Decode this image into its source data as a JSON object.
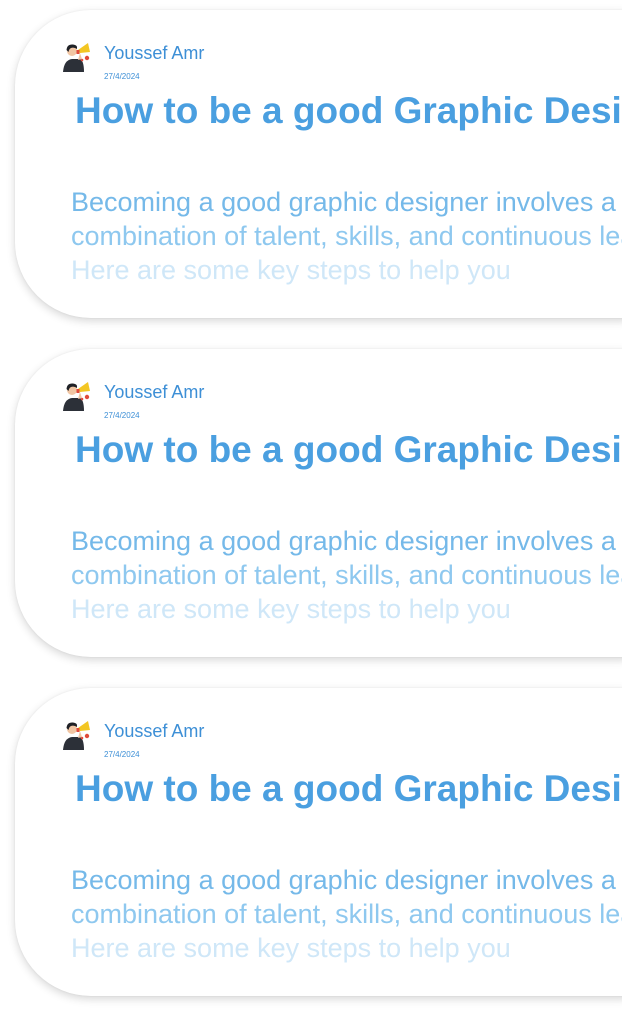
{
  "colors": {
    "accent": "#3d8fd6",
    "title": "#4a9fe0",
    "excerpt": "#75b9e9",
    "excerpt_faded": "#cfe7f8",
    "card_background": "#ffffff"
  },
  "posts": [
    {
      "author": "Youssef Amr",
      "avatar_icon": "person-with-megaphone-avatar",
      "date": "27/4/2024",
      "title": "How to be a good Graphic Designer",
      "excerpt_lines": [
        "Becoming a good graphic designer involves a",
        "combination of talent, skills, and continuous learning.",
        "Here are some key steps to help you"
      ]
    },
    {
      "author": "Youssef Amr",
      "avatar_icon": "person-with-megaphone-avatar",
      "date": "27/4/2024",
      "title": "How to be a good Graphic Designer",
      "excerpt_lines": [
        "Becoming a good graphic designer involves a",
        "combination of talent, skills, and continuous learning.",
        "Here are some key steps to help you"
      ]
    },
    {
      "author": "Youssef Amr",
      "avatar_icon": "person-with-megaphone-avatar",
      "date": "27/4/2024",
      "title": "How to be a good Graphic Designer",
      "excerpt_lines": [
        "Becoming a good graphic designer involves a",
        "combination of talent, skills, and continuous learning.",
        "Here are some key steps to help you"
      ]
    }
  ]
}
